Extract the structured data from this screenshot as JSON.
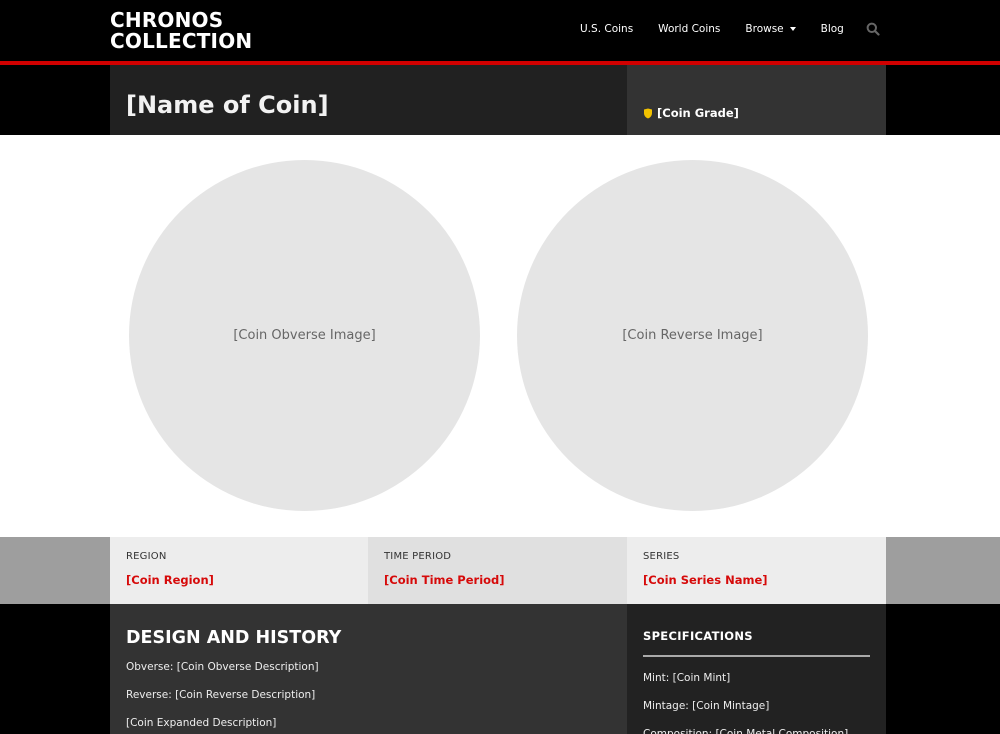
{
  "header": {
    "logo_line1": "CHRONOS",
    "logo_line2": "COLLECTION",
    "nav": [
      {
        "label": "U.S. Coins"
      },
      {
        "label": "World Coins"
      },
      {
        "label": "Browse",
        "has_dropdown": true
      },
      {
        "label": "Blog"
      }
    ],
    "search_icon": "search-icon"
  },
  "colors": {
    "accent_red": "#d10000",
    "value_red": "#d60a0a",
    "grade_shield": "#f2c200"
  },
  "coin": {
    "name": "[Name of Coin]",
    "grade": "[Coin Grade]",
    "grade_icon": "shield-icon",
    "obverse_image": "[Coin Obverse Image]",
    "reverse_image": "[Coin Reverse Image]"
  },
  "info": [
    {
      "label": "REGION",
      "value": "[Coin Region]"
    },
    {
      "label": "TIME PERIOD",
      "value": "[Coin Time Period]"
    },
    {
      "label": "SERIES",
      "value": "[Coin Series Name]"
    }
  ],
  "design": {
    "heading": "DESIGN AND HISTORY",
    "lines": [
      "Obverse: [Coin Obverse Description]",
      "Reverse: [Coin Reverse Description]",
      "[Coin Expanded Description]"
    ]
  },
  "specs": {
    "heading": "SPECIFICATIONS",
    "lines": [
      "Mint: [Coin Mint]",
      "Mintage: [Coin Mintage]",
      "Composition: [Coin Metal Composition]"
    ]
  }
}
